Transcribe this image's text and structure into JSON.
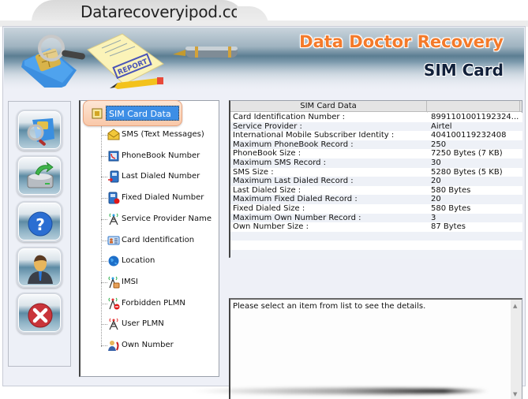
{
  "site": {
    "label": "Datarecoveryipod.com"
  },
  "header": {
    "brand_title": "Data Doctor Recovery",
    "brand_subtitle": "SIM Card",
    "report_stamp": "REPORT",
    "colors": {
      "brand_title": "#f47a2a",
      "brand_subtitle": "#11203a"
    }
  },
  "toolbar": {
    "buttons": [
      {
        "name": "scan-sim",
        "icon": "sim-magnifier-icon"
      },
      {
        "name": "save-data",
        "icon": "drive-save-icon"
      },
      {
        "name": "help",
        "icon": "help-icon"
      },
      {
        "name": "about",
        "icon": "user-icon"
      },
      {
        "name": "exit",
        "icon": "close-icon"
      }
    ]
  },
  "tree": {
    "root": {
      "label": "SIM Card Data",
      "icon": "sim-card-icon",
      "selected": true
    },
    "items": [
      {
        "label": "SMS (Text Messages)",
        "icon": "sms-envelope-icon"
      },
      {
        "label": "PhoneBook Number",
        "icon": "phonebook-icon"
      },
      {
        "label": "Last Dialed Number",
        "icon": "last-dialed-icon"
      },
      {
        "label": "Fixed Dialed Number",
        "icon": "fixed-dialed-icon"
      },
      {
        "label": "Service Provider Name",
        "icon": "antenna-icon"
      },
      {
        "label": "Card Identification",
        "icon": "id-card-icon"
      },
      {
        "label": "Location",
        "icon": "globe-icon"
      },
      {
        "label": "IMSI",
        "icon": "imsi-antenna-icon"
      },
      {
        "label": "Forbidden PLMN",
        "icon": "forbidden-antenna-icon"
      },
      {
        "label": "User PLMN",
        "icon": "user-plmn-antenna-icon"
      },
      {
        "label": "Own Number",
        "icon": "own-number-icon"
      }
    ]
  },
  "grid": {
    "columns": [
      "SIM Card Data",
      ""
    ],
    "rows": [
      {
        "key": "Card Identification Number :",
        "value": "8991101001192324..."
      },
      {
        "key": "Service Provider :",
        "value": "Airtel"
      },
      {
        "key": "International Mobile Subscriber Identity :",
        "value": "404100119232408"
      },
      {
        "key": "Maximum PhoneBook Record :",
        "value": "250"
      },
      {
        "key": "PhoneBook Size :",
        "value": "7250 Bytes (7 KB)"
      },
      {
        "key": "Maximum SMS Record :",
        "value": "30"
      },
      {
        "key": "SMS Size :",
        "value": "5280 Bytes (5 KB)"
      },
      {
        "key": "Maximum Last Dialed Record :",
        "value": "20"
      },
      {
        "key": "Last Dialed Size :",
        "value": "580 Bytes"
      },
      {
        "key": "Maximum Fixed Dialed Record :",
        "value": "20"
      },
      {
        "key": "Fixed Dialed Size :",
        "value": "580 Bytes"
      },
      {
        "key": "Maximum Own Number Record :",
        "value": "3"
      },
      {
        "key": "Own Number Size :",
        "value": "87 Bytes"
      },
      {
        "key": "",
        "value": ""
      },
      {
        "key": "",
        "value": ""
      },
      {
        "key": "",
        "value": ""
      }
    ]
  },
  "details": {
    "text": "Please select an item from list to see the details.",
    "scroll_up": "▲",
    "scroll_down": "▼"
  }
}
